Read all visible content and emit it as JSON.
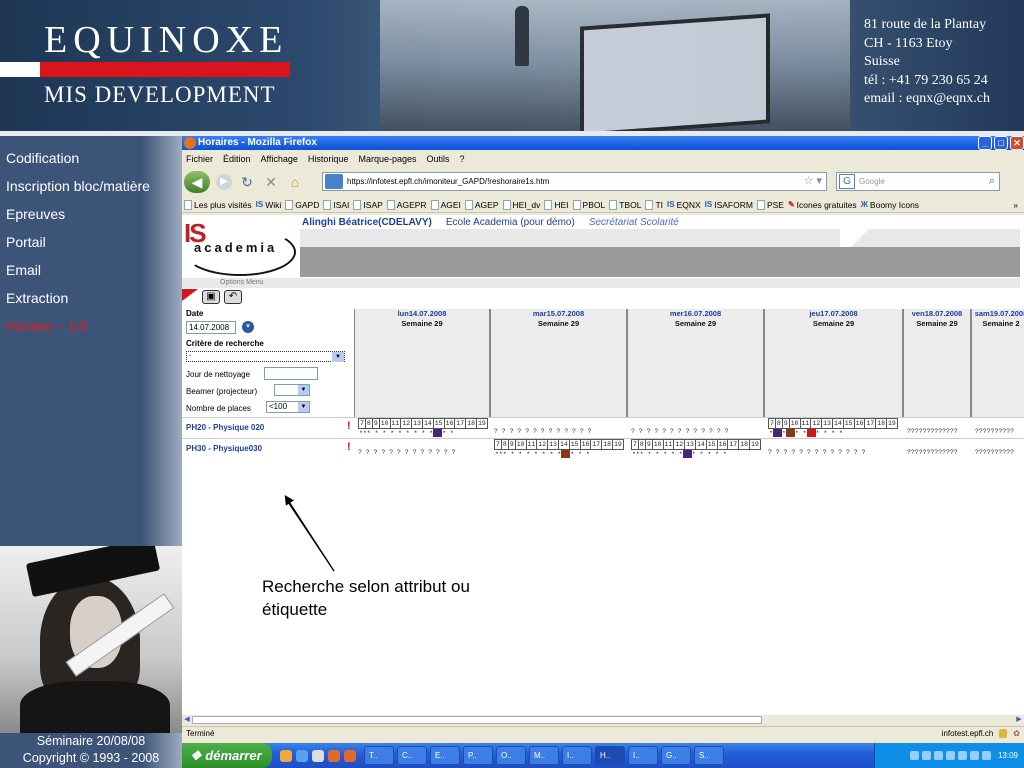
{
  "banner": {
    "brand": "EQUINOXE",
    "subtitle": "MIS DEVELOPMENT",
    "address": [
      "81 route de la Plantay",
      "CH - 1163 Etoy",
      "Suisse",
      "tél : +41 79 230 65 24",
      "email : eqnx@eqnx.ch"
    ]
  },
  "sidebar": {
    "items": [
      {
        "label": "Codification",
        "active": false
      },
      {
        "label": "Inscription bloc/matière",
        "active": false
      },
      {
        "label": "Epreuves",
        "active": false
      },
      {
        "label": "Portail",
        "active": false
      },
      {
        "label": "Email",
        "active": false
      },
      {
        "label": "Extraction",
        "active": false
      },
      {
        "label": "Horaire – 1/3",
        "active": true
      }
    ],
    "footer_line1": "Séminaire 20/08/08",
    "footer_line2": "Copyright © 1993 - 2008",
    "active_color": "#e01c1c"
  },
  "browser": {
    "title": "Horaires - Mozilla Firefox",
    "menu": [
      "Fichier",
      "Édition",
      "Affichage",
      "Historique",
      "Marque-pages",
      "Outils",
      "?"
    ],
    "url": "https://infotest.epfl.ch/imoniteur_GAPD/!reshoraire1s.htm",
    "search_placeholder": "Google",
    "bookmarks": [
      "Les plus visités",
      "Wiki",
      "GAPD",
      "ISAI",
      "ISAP",
      "AGEPR",
      "AGEI",
      "AGEP",
      "HEI_dv",
      "HEI",
      "PBOL",
      "TBOL",
      "TI",
      "EQNX",
      "ISAFORM",
      "PSE",
      "Icones gratuites",
      "Boomy Icons"
    ],
    "status_left": "Terminé",
    "status_right": "infotest.epfl.ch"
  },
  "app": {
    "logo_is": "IS",
    "logo_academia": "academia",
    "user": "Alinghi Béatrice(CDELAVY)",
    "ecole": "Ecole Academia (pour démo)",
    "secretariat": "Secrétariat Scolarité",
    "options_label": "Options   Menu",
    "form": {
      "date_label": "Date",
      "date_value": "14.07.2008",
      "criteria_label": "Critère de recherche",
      "criteria_value": "-",
      "jour_label": "Jour de nettoyage",
      "beamer_label": "Beamer (projecteur)",
      "places_label": "Nombre de places",
      "places_value": "<100"
    },
    "days": [
      {
        "date": "lun14.07.2008",
        "week": "Semaine 29"
      },
      {
        "date": "mar15.07.2008",
        "week": "Semaine 29"
      },
      {
        "date": "mer16.07.2008",
        "week": "Semaine 29"
      },
      {
        "date": "jeu17.07.2008",
        "week": "Semaine 29"
      },
      {
        "date": "ven18.07.2008",
        "week": "Semaine 29"
      },
      {
        "date": "sam19.07.2008",
        "week": "Semaine 2"
      }
    ],
    "rooms": [
      "PH20 - Physique 020",
      "PH30 - Physique030"
    ],
    "hours": [
      "7",
      "8",
      "9",
      "10",
      "11",
      "12",
      "13",
      "14",
      "15",
      "16",
      "17",
      "18",
      "19"
    ],
    "row1": {
      "mon_status": "*** * * * * * * * *",
      "mon_tail": " * *",
      "tue": "? ? ? ? ? ? ? ? ? ? ? ? ?",
      "wed": "? ? ? ? ? ? ? ? ? ? ? ? ?",
      "thu_a": "* ",
      "thu_b": " * ",
      "thu_c": " * * ",
      "thu_d": " * * * *",
      "fri": "?????????????",
      "sat": "??????????"
    },
    "row2": {
      "mon": "? ? ? ? ? ? ? ? ? ? ? ? ?",
      "tue_a": "*** * * * * * * * ",
      "tue_b": " * * *",
      "wed_a": "*** * * * * * ",
      "wed_b": " * * * * *",
      "thu": "? ? ? ? ? ? ? ? ? ? ? ? ?",
      "fri": "?????????????",
      "sat": "??????????"
    },
    "annotation": "Recherche selon attribut ou étiquette"
  },
  "taskbar": {
    "start": "démarrer",
    "tasks": [
      "T..",
      "C..",
      "E..",
      "P..",
      "O..",
      "M..",
      "I..",
      "H..",
      "I..",
      "G..",
      "S.."
    ],
    "active_task": "H..",
    "clock": "13:09"
  }
}
